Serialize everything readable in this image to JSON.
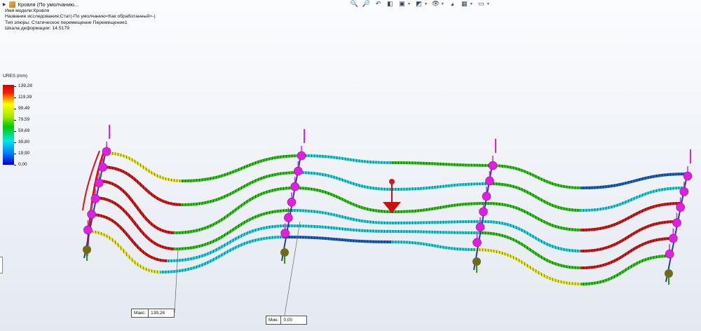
{
  "title": {
    "text": "Кровля  (По умолчанию..."
  },
  "info": {
    "model": "Имя модели:Кровля",
    "study": "Название исследования:Стат(-По умолчанию<Как обработанный>-)",
    "plot_type": "Тип эпюры: Статическое перемещение Перемещение1",
    "scale": "Шкала деформации: 14.5179"
  },
  "toolbar": [
    "zoom-fit-icon",
    "zoom-area-icon",
    "previous-view-icon",
    "section-view-icon",
    "view-orientation-icon",
    "display-style-icon",
    "hide-show-icon",
    "edit-appearance-icon",
    "apply-scene-icon",
    "view-settings-icon"
  ],
  "legend": {
    "title": "URES (mm)",
    "values": [
      "139,28",
      "119,39",
      "99,49",
      "79,59",
      "59,69",
      "39,80",
      "19,90",
      "0,00"
    ]
  },
  "callouts": {
    "max_label": "Макс:",
    "max_value": "139,28",
    "min_label": "Мин:",
    "min_value": "0,00"
  },
  "colors": {
    "red": "#e01010",
    "yellow": "#e8e800",
    "green": "#22cc00",
    "cyan": "#10d8e0",
    "blue": "#1060d0",
    "fixture": "#e020e0",
    "load": "#c81010"
  }
}
